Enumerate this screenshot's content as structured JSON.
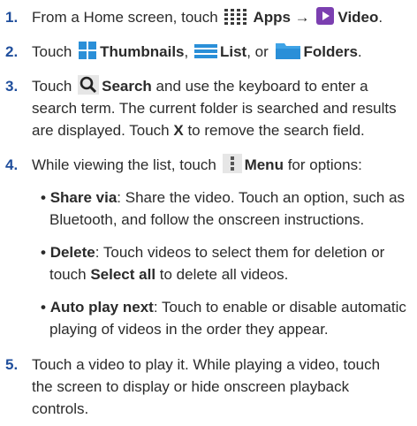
{
  "steps": [
    {
      "number": "1.",
      "p1": "From a Home screen, touch",
      "apps": "Apps",
      "arrow": "→",
      "video": "Video",
      "end": "."
    },
    {
      "number": "2.",
      "touch": "Touch",
      "thumbnails": "Thumbnails",
      "comma1": ",",
      "list": "List",
      "or": ", or",
      "folders": "Folders",
      "end": "."
    },
    {
      "number": "3.",
      "touch": "Touch",
      "search": "Search",
      "l1rest": "and use the keyboard to enter a",
      "l2": "search term. The current folder is searched and results",
      "l3a": "are displayed. Touch",
      "x": "X",
      "l3b": "to remove the search field."
    },
    {
      "number": "4.",
      "p1": "While viewing the list, touch",
      "menu": "Menu",
      "p2": "for options:",
      "bullets": [
        {
          "dot": "•",
          "term": "Share via",
          "l1": ": Share the video. Touch an option, such as",
          "l2": "Bluetooth, and follow the onscreen instructions."
        },
        {
          "dot": "•",
          "term": "Delete",
          "l1": ": Touch videos to select them for deletion or",
          "l2a": "touch",
          "l2b": "Select all",
          "l2c": "to delete all videos."
        },
        {
          "dot": "•",
          "term": "Auto play next",
          "l1": ": Touch to enable or disable automatic",
          "l2": "playing of videos in the order they appear."
        }
      ]
    },
    {
      "number": "5.",
      "l1": "Touch a video to play it. While playing a video, touch",
      "l2": "the screen to display or hide onscreen playback",
      "l3": "controls."
    }
  ],
  "icons": {
    "apps": "apps-grid-icon",
    "video": "video-play-icon",
    "thumbnails": "thumbnails-icon",
    "list": "list-icon",
    "folders": "folder-icon",
    "search": "search-icon",
    "menu": "menu-dots-icon"
  },
  "colors": {
    "number": "#1f4e9c",
    "icon_blue": "#2a8fd8",
    "video_purple": "#7b3fb0"
  }
}
